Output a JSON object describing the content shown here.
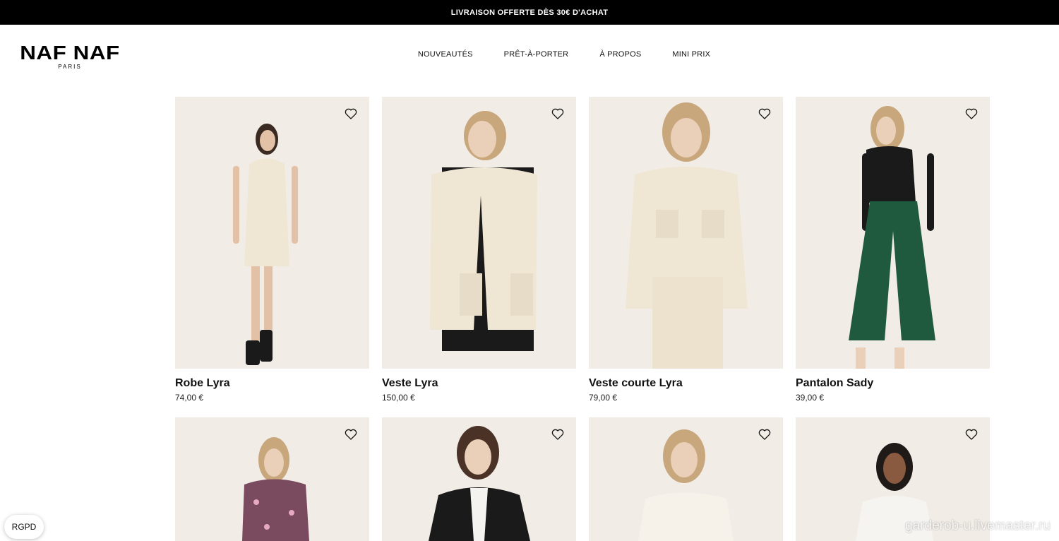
{
  "promo": {
    "text": "LIVRAISON OFFERTE DÈS 30€ D'ACHAT"
  },
  "logo": {
    "main": "NAF NAF",
    "sub": "PARIS"
  },
  "nav": [
    {
      "label": "NOUVEAUTÉS"
    },
    {
      "label": "PRÊT-À-PORTER"
    },
    {
      "label": "À PROPOS"
    },
    {
      "label": "MINI PRIX"
    }
  ],
  "products": [
    {
      "name": "Robe Lyra",
      "price": "74,00 €",
      "garment": "cream-dress"
    },
    {
      "name": "Veste Lyra",
      "price": "150,00 €",
      "garment": "cream-jacket"
    },
    {
      "name": "Veste courte Lyra",
      "price": "79,00 €",
      "garment": "cream-cropped-jacket"
    },
    {
      "name": "Pantalon Sady",
      "price": "39,00 €",
      "garment": "green-trousers"
    },
    {
      "name": "",
      "price": "",
      "garment": "floral-blouse"
    },
    {
      "name": "",
      "price": "",
      "garment": "leather-jacket"
    },
    {
      "name": "",
      "price": "",
      "garment": "white-blouse"
    },
    {
      "name": "",
      "price": "",
      "garment": "white-sweater"
    }
  ],
  "rgpd": {
    "label": "RGPD"
  },
  "watermark": {
    "text": "garderob-u.livemaster.ru"
  },
  "colors": {
    "promo_bg": "#000000",
    "photo_bg": "#f1ece6",
    "cream": "#efe6d4",
    "green": "#1f5a3e",
    "black": "#1a1a1a"
  }
}
